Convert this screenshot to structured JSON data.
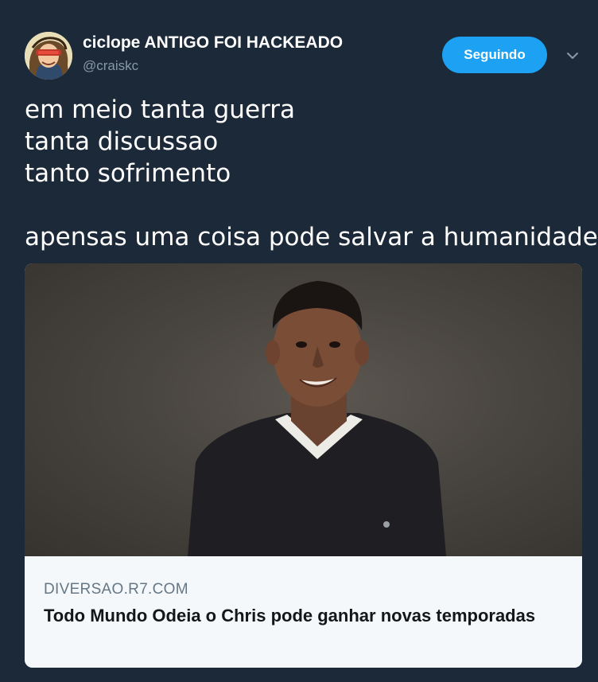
{
  "user": {
    "display_name": "ciclope ANTIGO FOI HACKEADO",
    "handle": "@craiskc"
  },
  "follow_button": {
    "label": "Seguindo"
  },
  "tweet": {
    "lines": [
      "em meio tanta guerra",
      "tanta discussao",
      "tanto sofrimento",
      "apensas uma coisa pode salvar a humanidade"
    ]
  },
  "card": {
    "domain": "DIVERSAO.R7.COM",
    "title": "Todo Mundo Odeia o Chris pode ganhar novas temporadas"
  },
  "colors": {
    "background": "#1c2938",
    "accent": "#1da1f2",
    "secondary_text": "#8899a6",
    "card_background": "#f5f8fa"
  },
  "icons": {
    "menu": "chevron-down-icon"
  }
}
